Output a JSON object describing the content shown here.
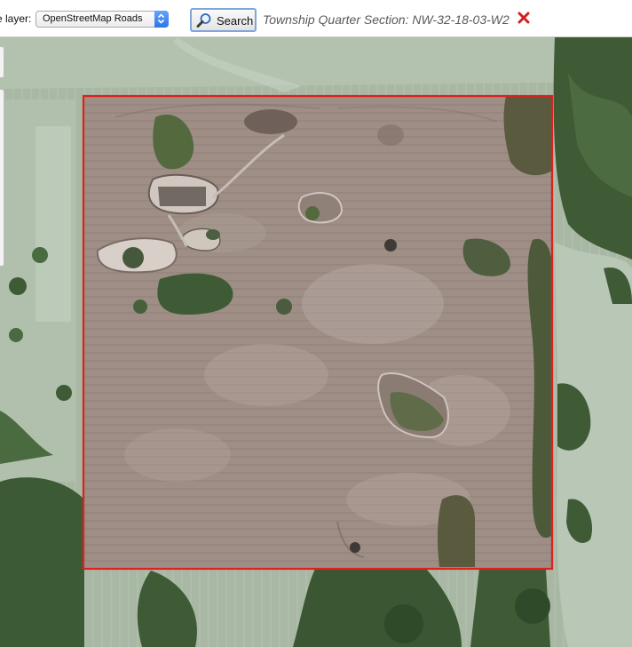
{
  "toolbar": {
    "layer_label": "e layer:",
    "layer_select_value": "OpenStreetMap Roads",
    "search_label": "Search",
    "result_text": "Township Quarter Section: NW-32-18-03-W2"
  },
  "icons": {
    "search": "magnifier-icon",
    "clear": "red-x-icon",
    "select": "up-down-arrows-icon"
  },
  "colors": {
    "boundary": "#e0201e",
    "field": "#9e8e85",
    "grass": "#a8b8a4",
    "trees": "#3f5b36",
    "clear_x": "#d21f1f",
    "select_accent": "#3b82f6"
  }
}
